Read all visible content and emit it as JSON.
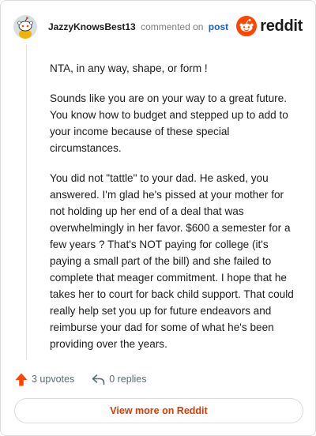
{
  "header": {
    "username": "JazzyKnowsBest13",
    "commented_text": "commented on",
    "post_link": "post",
    "brand": "reddit",
    "avatar_icon": "snoo-avatar-icon",
    "brand_icon": "reddit-logo-icon"
  },
  "comment": {
    "paragraphs": [
      "NTA, in any way, shape, or form !",
      "Sounds like you are on your way to a great future. You know how to budget and stepped up to add to your income because of these special circumstances.",
      "You did not \"tattle\" to your dad. He asked, you answered. I'm glad he's pissed at your mother for not holding up her end of a deal that was overwhelmingly in her favor. $600 a semester for a few years ? That's NOT paying for college (it's paying a small part of the bill) and she failed to complete that meager commitment. I hope that he takes her to court for back child support. That could really help set you up for future endeavors and reimburse your dad for some of what he's been providing over the years."
    ]
  },
  "actions": {
    "upvotes": "3 upvotes",
    "replies": "0 replies",
    "upvote_icon": "upvote-arrow-icon",
    "reply_icon": "reply-arrow-icon"
  },
  "footer": {
    "view_more": "View more on Reddit"
  },
  "colors": {
    "accent": "#d93a00",
    "brand_orange": "#ff4500",
    "link_blue": "#1a5ccc"
  }
}
